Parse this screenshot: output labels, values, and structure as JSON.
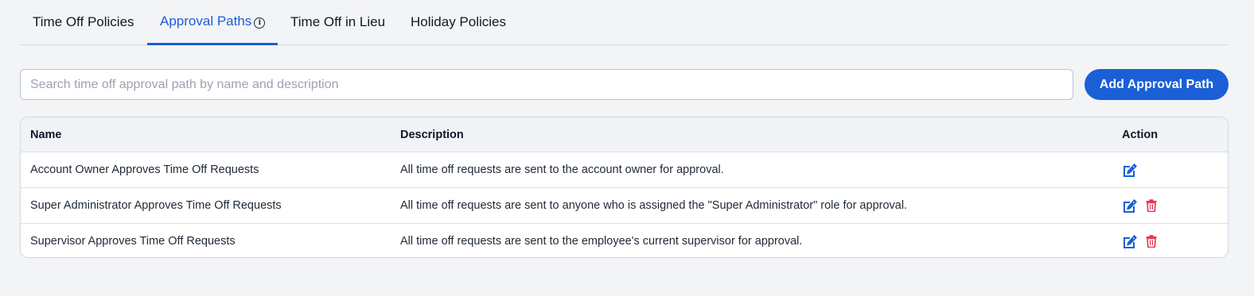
{
  "tabs": [
    {
      "label": "Time Off Policies",
      "active": false
    },
    {
      "label": "Approval Paths",
      "active": true,
      "icon": "info-icon"
    },
    {
      "label": "Time Off in Lieu",
      "active": false
    },
    {
      "label": "Holiday Policies",
      "active": false
    }
  ],
  "search": {
    "placeholder": "Search time off approval path by name and description",
    "value": ""
  },
  "add_button": {
    "label": "Add Approval Path"
  },
  "table": {
    "headers": {
      "name": "Name",
      "description": "Description",
      "action": "Action"
    },
    "rows": [
      {
        "name": "Account Owner Approves Time Off Requests",
        "description": "All time off requests are sent to the account owner for approval.",
        "actions": [
          "edit-icon"
        ]
      },
      {
        "name": "Super Administrator Approves Time Off Requests",
        "description": "All time off requests are sent to anyone who is assigned the \"Super Administrator\" role for approval.",
        "actions": [
          "edit-icon",
          "trash-icon"
        ]
      },
      {
        "name": "Supervisor Approves Time Off Requests",
        "description": "All time off requests are sent to the employee's current supervisor for approval.",
        "actions": [
          "edit-icon",
          "trash-icon"
        ]
      }
    ]
  },
  "colors": {
    "accent": "#1a5fd6",
    "delete": "#e0334e",
    "background": "#f3f4f6"
  }
}
